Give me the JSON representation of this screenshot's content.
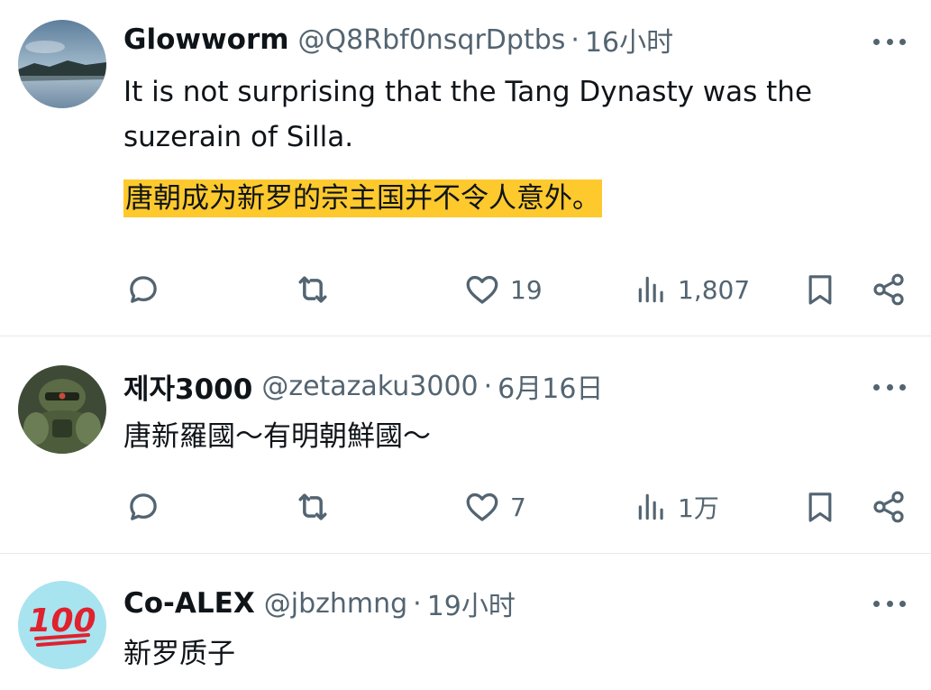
{
  "tweets": [
    {
      "name": "Glowworm",
      "handle": "@Q8Rbf0nsqrDptbs",
      "separator": "·",
      "time": "16小时",
      "text_line1": "It is not surprising that the Tang Dynasty was the",
      "text_line2": "suzerain of Silla.",
      "translation": "唐朝成为新罗的宗主国并不令人意外。",
      "likes": "19",
      "views": "1,807",
      "avatar_icon": "lake-landscape-avatar"
    },
    {
      "name": "제자3000",
      "handle": "@zetazaku3000",
      "separator": "·",
      "time": "6月16日",
      "text_line1": "唐新羅國～有明朝鮮國～",
      "likes": "7",
      "views": "1万",
      "avatar_icon": "robot-avatar"
    },
    {
      "name": "Co-ALEX",
      "handle": "@jbzhmng",
      "separator": "·",
      "time": "19小时",
      "text_line1": "新罗质子",
      "avatar_icon": "hundred-points-emoji-avatar",
      "avatar_text": "100"
    }
  ],
  "icons": {
    "reply": "reply-icon",
    "retweet": "retweet-icon",
    "like": "heart-icon",
    "views": "views-icon",
    "bookmark": "bookmark-icon",
    "share": "share-icon",
    "more": "more-icon"
  },
  "colors": {
    "text": "#0f1419",
    "secondary": "#536471",
    "highlight": "#fdc92d",
    "divider": "#e6e9ec"
  }
}
